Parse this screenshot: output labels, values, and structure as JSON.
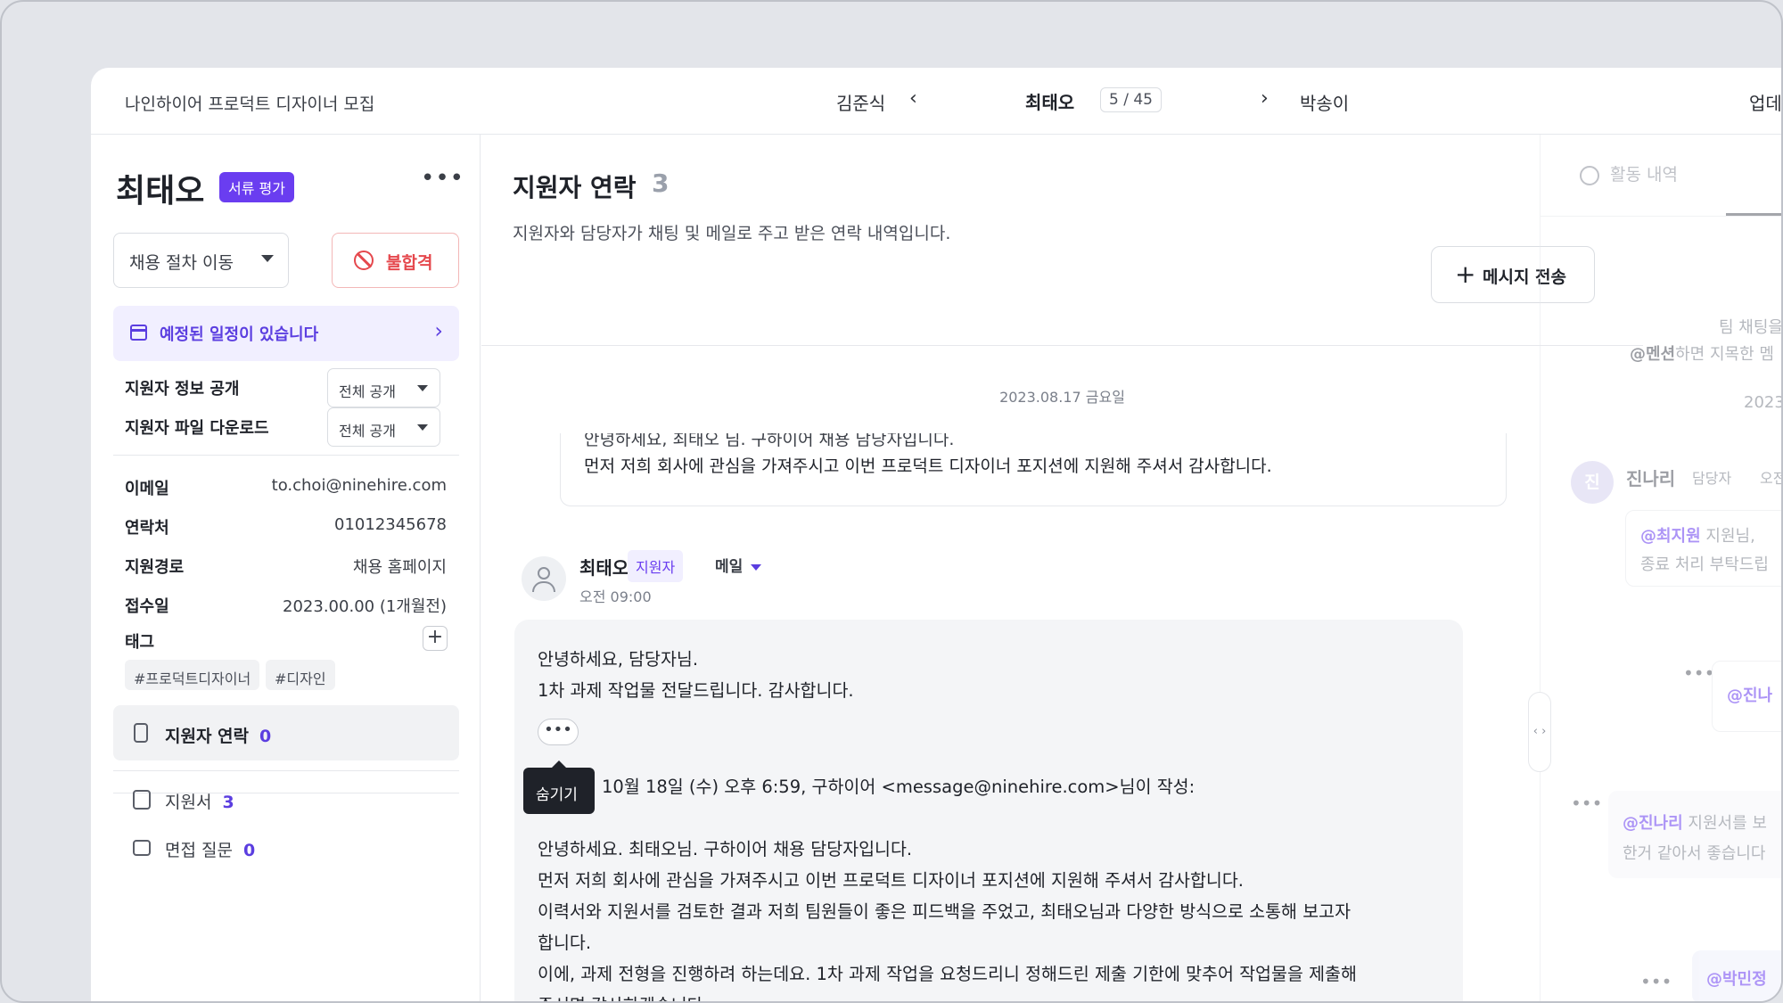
{
  "topbar": {
    "title": "나인하이어 프로덕트 디자이너 모집",
    "prev_name": "김준식",
    "current_name": "최태오",
    "position": "5 / 45",
    "next_name": "박송이",
    "update_label": "업데"
  },
  "left": {
    "name": "최태오",
    "stage": "서류 평가",
    "more": "•••",
    "move_label": "채용 절차 이동",
    "reject_label": "불합격",
    "schedule_label": "예정된 일정이 있습니다",
    "settings": [
      {
        "label": "지원자 정보 공개",
        "value": "전체 공개"
      },
      {
        "label": "지원자 파일 다운로드",
        "value": "전체 공개"
      }
    ],
    "info": [
      {
        "label": "이메일",
        "value": "to.choi@ninehire.com"
      },
      {
        "label": "연락처",
        "value": "01012345678"
      },
      {
        "label": "지원경로",
        "value": "채용 홈페이지"
      },
      {
        "label": "접수일",
        "value": "2023.00.00 (1개월전)"
      }
    ],
    "tag_label": "태그",
    "tags": [
      "#프로덕트디자이너",
      "#디자인"
    ],
    "nav": [
      {
        "label": "지원자 연락",
        "count": "0"
      },
      {
        "label": "지원서",
        "count": "3"
      },
      {
        "label": "면접 질문",
        "count": "0"
      }
    ]
  },
  "center": {
    "title": "지원자 연락",
    "title_count": "3",
    "subtitle": "지원자와 담당자가 채팅 및 메일로 주고 받은 연락 내역입니다.",
    "send_label": "메시지 전송",
    "date": "2023.08.17 금요일",
    "prev_msg": {
      "line1": "안녕하세요, 최태오 님. 구하이어 채용 담당자입니다.",
      "line2": "먼저 저희 회사에 관심을 가져주시고 이번 프로덕트 디자이너 포지션에 지원해 주셔서 감사합니다."
    },
    "msg": {
      "sender": "최태오",
      "badge": "지원자",
      "channel": "메일",
      "time": "오전 09:00",
      "greeting": "안녕하세요, 담당자님.",
      "body": "1차 과제 작업물 전달드립니다. 감사합니다.",
      "dots": "•••",
      "tooltip": "숨기기",
      "quote_header": "10월 18일 (수) 오후 6:59, 구하이어 <message@ninehire.com>님이 작성:",
      "quote": [
        "안녕하세요. 최태오님. 구하이어 채용 담당자입니다.",
        "먼저 저희 회사에 관심을 가져주시고 이번 프로덕트 디자이너 포지션에 지원해 주셔서 감사합니다.",
        "이력서와 지원서를 검토한 결과 저희 팀원들이 좋은 피드백을 주었고, 최태오님과 다양한 방식으로 소통해 보고자",
        "합니다.",
        "이에, 과제 전형을 진행하려 하는데요. 1차 과제 작업을 요청드리니 정해드린 제출 기한에 맞추어 작업물을 제출해",
        "주시면 감사하겠습니다."
      ]
    }
  },
  "right": {
    "tab_activity": "활동 내역",
    "hint1": "팀 채팅을 ",
    "hint2_bold": "@멘션",
    "hint2": "하면 지목한 멤",
    "date": "2023",
    "user_initial": "진",
    "user_name": "진나리",
    "user_role": "담당자",
    "user_time": "오전",
    "msg1_mention": "@최지원",
    "msg1_text": " 지원님, ",
    "msg1_line2": "종료 처리 부탁드립",
    "mention_jin": "@진나",
    "msg3_mention": "@진나리",
    "msg3_text": " 지원서를 보",
    "msg3_line2": "한거 같아서 좋습니다",
    "mention_park": "@박민정",
    "dots": "•••"
  }
}
